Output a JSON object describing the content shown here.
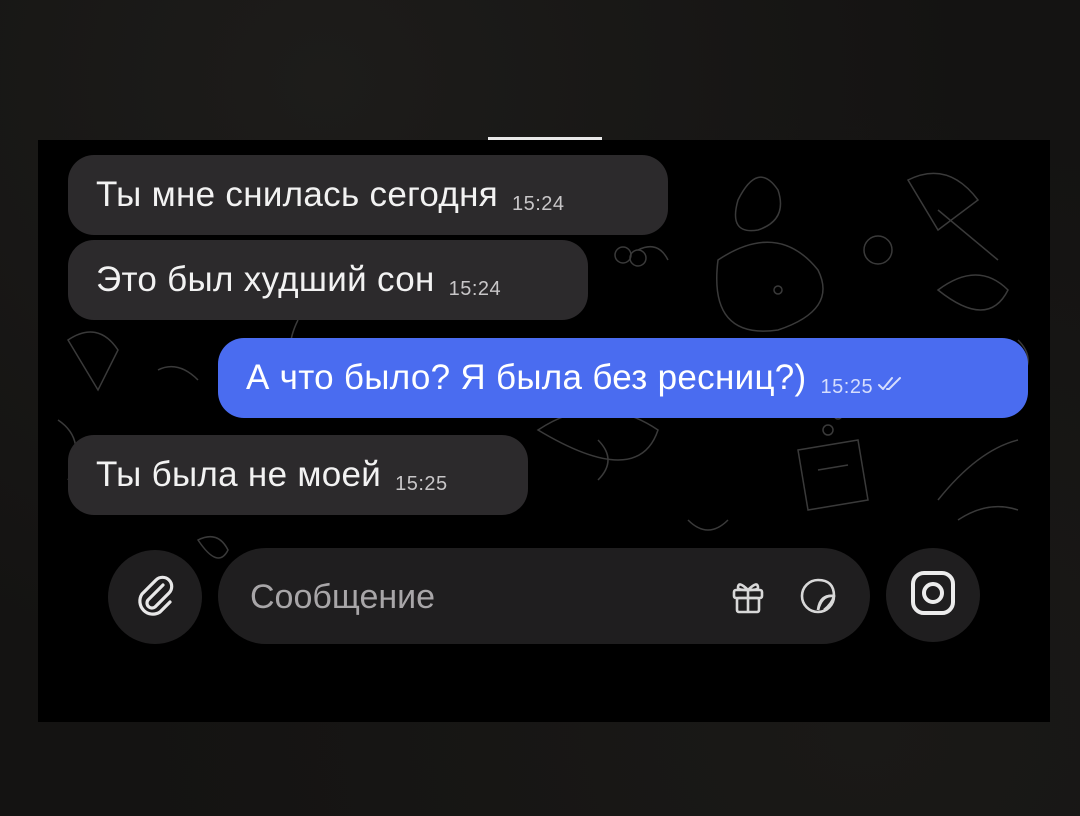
{
  "messages": [
    {
      "direction": "incoming",
      "text": "Ты мне снилась сегодня",
      "time": "15:24"
    },
    {
      "direction": "incoming",
      "text": "Это был худший сон",
      "time": "15:24"
    },
    {
      "direction": "outgoing",
      "text": "А что было? Я была без ресниц?)",
      "time": "15:25",
      "status_icon": "double-check-icon"
    },
    {
      "direction": "incoming",
      "text": "Ты была не моей",
      "time": "15:25"
    }
  ],
  "composer": {
    "placeholder": "Сообщение",
    "value": "",
    "attach_icon": "paperclip-icon",
    "gift_icon": "gift-icon",
    "sticker_icon": "sticker-icon",
    "camera_icon": "camera-icon"
  },
  "colors": {
    "incoming_bubble": "#2c2a2c",
    "outgoing_bubble": "#4a6cf0",
    "chat_background": "#000000",
    "input_background": "#1f1e1f"
  }
}
